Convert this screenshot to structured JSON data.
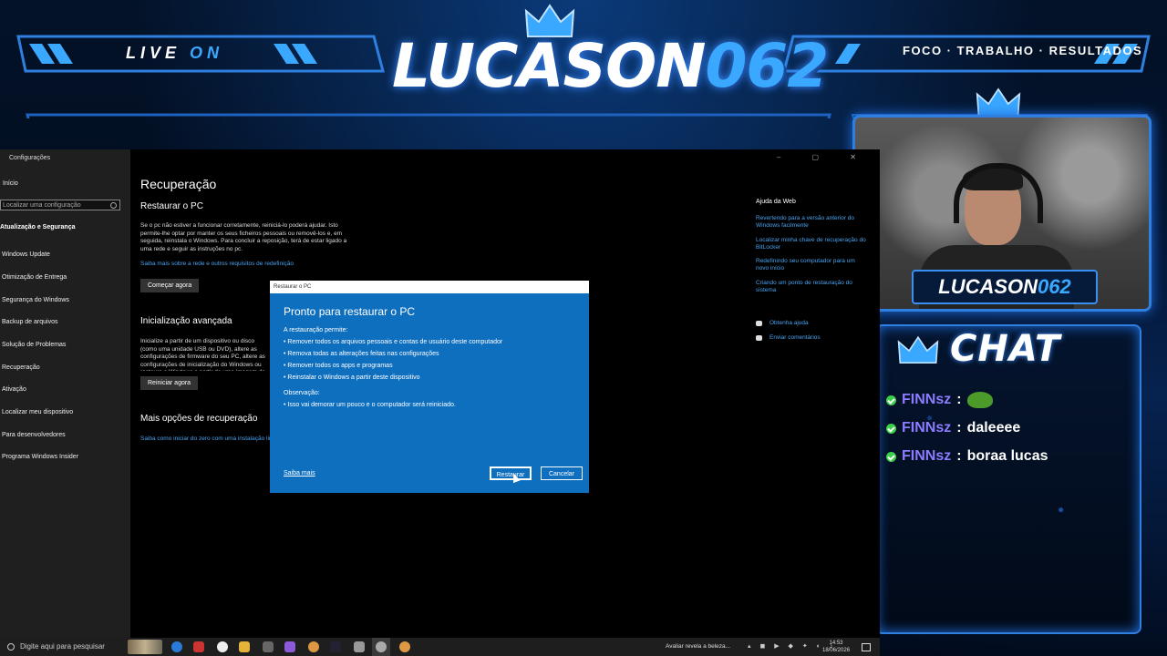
{
  "overlay": {
    "live_label_1": "LIVE",
    "live_label_2": "ON",
    "logo_text_1": "LUCASON",
    "logo_text_2": "062",
    "tagline": "FOCO · TRABALHO · RESULTADOS",
    "cam_name_1": "LUCASON",
    "cam_name_2": "062",
    "chat_title": "CHAT",
    "accent_color": "#3aa8ff",
    "chat_messages": [
      {
        "user": "FINNsz",
        "sep": ":",
        "text": "",
        "emote": "pepe-emote"
      },
      {
        "user": "FINNsz",
        "sep": ":",
        "text": "daleeee"
      },
      {
        "user": "FINNsz",
        "sep": ":",
        "text": "boraa lucas"
      }
    ]
  },
  "window": {
    "title": "Configurações",
    "controls": "– ▢ ✕"
  },
  "sidebar": {
    "home": "Início",
    "search_placeholder": "Localizar uma configuração",
    "section": "Atualização e Segurança",
    "items": [
      "Windows Update",
      "Otimização de Entrega",
      "Segurança do Windows",
      "Backup de arquivos",
      "Solução de Problemas",
      "Recuperação",
      "Ativação",
      "Localizar meu dispositivo",
      "Para desenvolvedores",
      "Programa Windows Insider"
    ]
  },
  "main": {
    "title": "Recuperação",
    "reset_heading": "Restaurar o PC",
    "reset_text": "Se o pc não estiver a funcionar corretamente, reiniciá-lo poderá ajudar. Isto permite-lhe optar por manter os seus ficheiros pessoais ou removê-los e, em seguida, reinstala o Windows. Para concluir a reposição, terá de estar ligado a uma rede e seguir as instruções no pc.",
    "reset_link": "Saiba mais sobre a rede e outros requisitos de redefinição",
    "reset_button": "Começar agora",
    "advanced_heading": "Inicialização avançada",
    "advanced_text": "Inicialize a partir de um dispositivo ou disco (como uma unidade USB ou DVD), altere as configurações de firmware do seu PC, altere as configurações de inicialização do Windows ou restaure o Windows a partir de uma imagem do sistema. Isto irá reiniciar o seu PC.",
    "advanced_button": "Reiniciar agora",
    "more_heading": "Mais opções de recuperação",
    "more_link": "Saiba como iniciar do zero com uma instalação limpa do Windows"
  },
  "help": {
    "title": "Ajuda da Web",
    "links": [
      "Revertendo para a versão anterior do Windows facilmente",
      "Localizar minha chave de recuperação do BitLocker",
      "Redefinindo seu computador para um novo início",
      "Criando um ponto de restauração do sistema"
    ],
    "get_help": "Obtenha ajuda",
    "feedback": "Enviar comentários"
  },
  "dialog": {
    "titlebar": "Restaurar o PC",
    "heading": "Pronto para restaurar o PC",
    "allows_label": "A restauração permite:",
    "bullets": [
      "Remover todos os arquivos pessoais e contas de usuário deste computador",
      "Remova todas as alterações feitas nas configurações",
      "Remover todos os apps e programas",
      "Reinstalar o Windows a partir deste dispositivo"
    ],
    "note_label": "Observação:",
    "note_bullet": "Isso vai demorar um pouco e o computador será reiniciado.",
    "learn_more": "Saiba mais",
    "restore_button": "Restaurar",
    "cancel_button": "Cancelar",
    "accent_color": "#0f6fbf"
  },
  "taskbar": {
    "search_placeholder": "Digite aqui para pesquisar",
    "notification": "Avaliar revela a beleza...",
    "time": "14:53",
    "date": "18/06/2026"
  }
}
